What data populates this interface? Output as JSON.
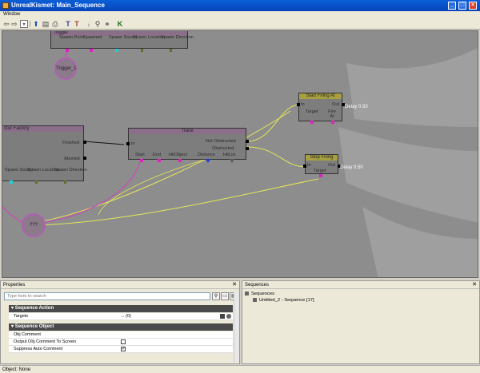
{
  "window": {
    "title": "UnrealKismet: Main_Sequence",
    "menu": [
      "Window"
    ]
  },
  "toolbar": {
    "icons": [
      "back-icon",
      "forward-icon",
      "dropdown-icon",
      "up-icon",
      "open-icon",
      "print-icon",
      "text-icon",
      "text-alt-icon",
      "search-icon",
      "zoom-icon",
      "link-icon",
      "k-icon"
    ]
  },
  "canvas": {
    "toggle_node": {
      "title": "Toggle",
      "pins": [
        "Spawn Point",
        "Spawned",
        "Spawn Sound",
        "Spawn Location",
        "Spawn Direction"
      ]
    },
    "trigger_var": {
      "label": "Trigger_1"
    },
    "factory_node": {
      "title": "ctor Factory",
      "out_finished": "Finished",
      "out_aborted": "Aborted",
      "pins": [
        "Spawn Sound",
        "Spawn Location",
        "Spawn Direction"
      ]
    },
    "trace_node": {
      "title": "Trace",
      "in_label": "In",
      "out_not_obstructed": "Not Obstructed",
      "out_obstructed": "Obstructed",
      "pins": [
        "Start",
        "End",
        "HitObject",
        "Distance",
        "HitLoc"
      ]
    },
    "var_circle": {
      "label": "???"
    },
    "start_firing": {
      "title": "Start Firing At",
      "in": "In",
      "out": "Out",
      "pins": [
        "Target",
        "Fire At"
      ],
      "delay": "Delay 0.50"
    },
    "stop_firing": {
      "title": "Stop Firing",
      "in": "In",
      "out": "Out",
      "pins": [
        "Target"
      ],
      "delay": "Delay 0.50"
    },
    "colors": {
      "wire_yellow": "#e6e65a",
      "wire_pink": "#d040c0",
      "pin_pink": "#e020c0"
    }
  },
  "properties": {
    "title": "Properties",
    "search_placeholder": "Type here to search",
    "categories": [
      {
        "name": "Sequence Action",
        "rows": [
          {
            "label": "Targets",
            "value": "... (0)"
          }
        ]
      },
      {
        "name": "Sequence Object",
        "rows": [
          {
            "label": "Obj Comment",
            "value": ""
          },
          {
            "label": "Output Obj Comment To Screen",
            "checked": false
          },
          {
            "label": "Suppress Auto Comment",
            "checked": true
          }
        ]
      }
    ]
  },
  "sequences": {
    "title": "Sequences",
    "root": "Sequences",
    "child": "Untitled_2 - Sequence [17]"
  },
  "status": {
    "text": "Object: None"
  }
}
